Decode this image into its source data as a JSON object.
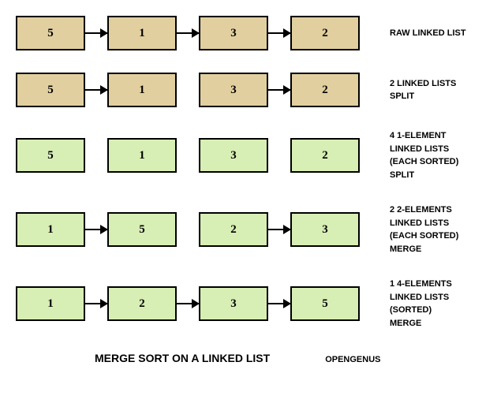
{
  "rows": [
    {
      "color": "tan",
      "nodes": [
        "5",
        "1",
        "3",
        "2"
      ],
      "connectors": [
        "arrow",
        "arrow",
        "arrow"
      ],
      "label": "RAW LINKED LIST"
    },
    {
      "color": "tan",
      "nodes": [
        "5",
        "1",
        "3",
        "2"
      ],
      "connectors": [
        "arrow",
        "gap",
        "arrow"
      ],
      "label": "2 LINKED LISTS\nSPLIT"
    },
    {
      "color": "green",
      "nodes": [
        "5",
        "1",
        "3",
        "2"
      ],
      "connectors": [
        "gap",
        "gap",
        "gap"
      ],
      "label": "4 1-ELEMENT\nLINKED LISTS\n(EACH SORTED)\nSPLIT"
    },
    {
      "color": "green",
      "nodes": [
        "1",
        "5",
        "2",
        "3"
      ],
      "connectors": [
        "arrow",
        "gap",
        "arrow"
      ],
      "label": "2 2-ELEMENTS\nLINKED LISTS\n(EACH SORTED)\nMERGE"
    },
    {
      "color": "green",
      "nodes": [
        "1",
        "2",
        "3",
        "5"
      ],
      "connectors": [
        "arrow",
        "arrow",
        "arrow"
      ],
      "label": "1 4-ELEMENTS\nLINKED LISTS\n(SORTED)\nMERGE"
    }
  ],
  "footer": {
    "title": "MERGE SORT ON A LINKED LIST",
    "credit": "OPENGENUS"
  }
}
